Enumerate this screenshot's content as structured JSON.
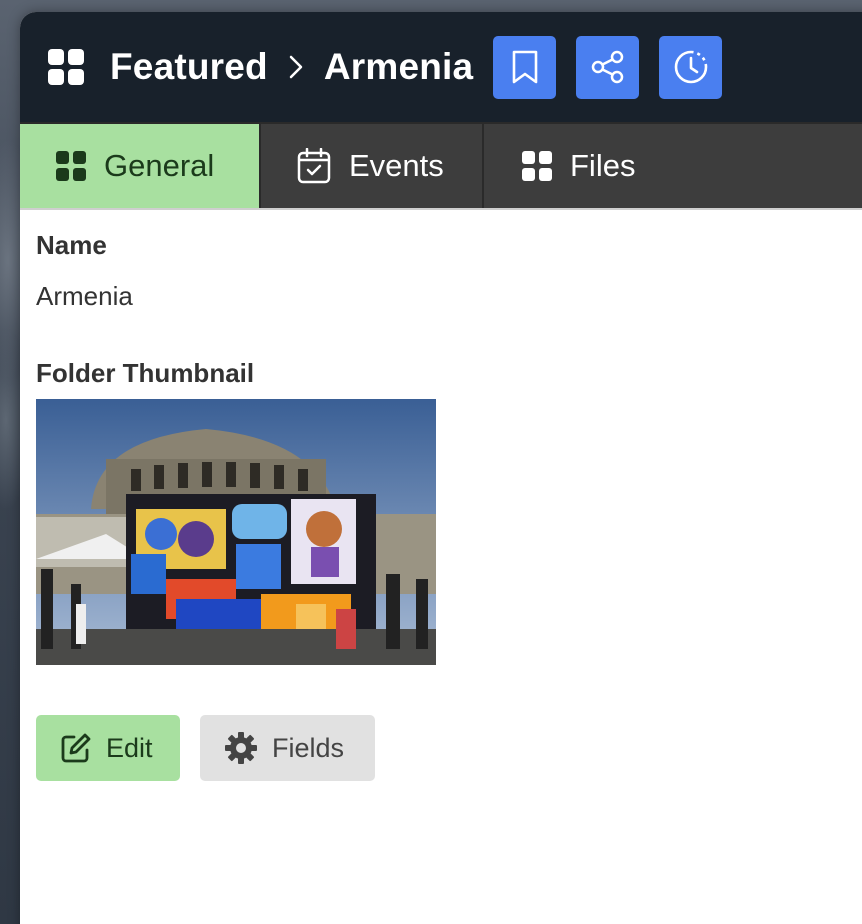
{
  "header": {
    "breadcrumb": [
      "Featured",
      "Armenia"
    ],
    "tools": [
      {
        "icon": "bookmark-icon",
        "color": "#4a7ff0"
      },
      {
        "icon": "share-icon",
        "color": "#4a7ff0"
      },
      {
        "icon": "history-icon",
        "color": "#4a7ff0"
      }
    ]
  },
  "tabs": [
    {
      "label": "General",
      "icon": "grid-icon",
      "active": true
    },
    {
      "label": "Events",
      "icon": "calendar-icon",
      "active": false
    },
    {
      "label": "Files",
      "icon": "grid-icon",
      "active": false
    }
  ],
  "fields": {
    "name_label": "Name",
    "name_value": "Armenia",
    "thumbnail_label": "Folder Thumbnail"
  },
  "actions": {
    "edit_label": "Edit",
    "fields_label": "Fields"
  },
  "colors": {
    "accent_green": "#a8e0a0",
    "accent_blue": "#4a7ff0",
    "header_bg": "#18212b",
    "tabs_bg": "#3d3d3d"
  }
}
